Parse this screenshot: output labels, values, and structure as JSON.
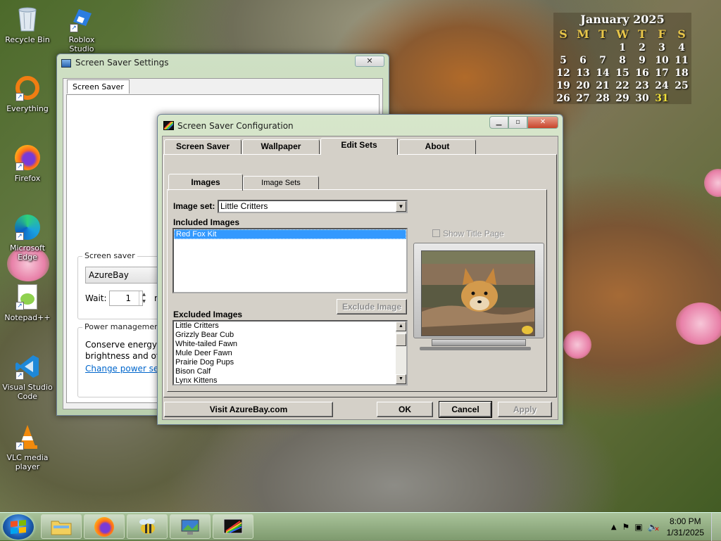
{
  "desktop": {
    "icons": [
      {
        "label": "Recycle Bin"
      },
      {
        "label": "Roblox Studio"
      },
      {
        "label": "Everything"
      },
      {
        "label": "Firefox"
      },
      {
        "label": "Microsoft Edge"
      },
      {
        "label": "Notepad++"
      },
      {
        "label": "Visual Studio Code"
      },
      {
        "label": "VLC media player"
      }
    ]
  },
  "calendar": {
    "title": "January 2025",
    "weekdays": [
      "S",
      "M",
      "T",
      "W",
      "T",
      "F",
      "S"
    ],
    "highlight_day": "31"
  },
  "screensaver_settings": {
    "title": "Screen Saver Settings",
    "close_glyph": "✕",
    "tab": "Screen Saver",
    "screensaver_group": "Screen saver",
    "screensaver_selected": "AzureBay",
    "wait_label": "Wait:",
    "wait_value": "1",
    "wait_units_partial": "m",
    "power_group": "Power management",
    "power_text_1": "Conserve energy or",
    "power_text_2": "brightness and othe",
    "power_link": "Change power setti"
  },
  "config": {
    "title": "Screen Saver Configuration",
    "tabs": [
      "Screen Saver",
      "Wallpaper",
      "Edit Sets",
      "About"
    ],
    "selected_tab": "Edit Sets",
    "subtabs": [
      "Images",
      "Image Sets"
    ],
    "selected_subtab": "Images",
    "image_set_label": "Image set:",
    "image_set_value": "Little Critters",
    "included_label": "Included Images",
    "included_items": [
      "Red Fox Kit"
    ],
    "excluded_label": "Excluded Images",
    "excluded_items": [
      "Little Critters",
      "Grizzly Bear Cub",
      "White-tailed Fawn",
      "Mule Deer Fawn",
      "Prairie Dog Pups",
      "Bison Calf",
      "Lynx Kittens"
    ],
    "exclude_button": "Exclude Image",
    "show_title_page": "Show Title Page",
    "visit_button": "Visit AzureBay.com",
    "ok_button": "OK",
    "cancel_button": "Cancel",
    "apply_button": "Apply"
  },
  "taskbar": {
    "time": "8:00 PM",
    "date": "1/31/2025"
  },
  "colors": {
    "selection": "#3399ff",
    "dialog_face": "#d4d0c8",
    "close_red": "#c8432a"
  }
}
